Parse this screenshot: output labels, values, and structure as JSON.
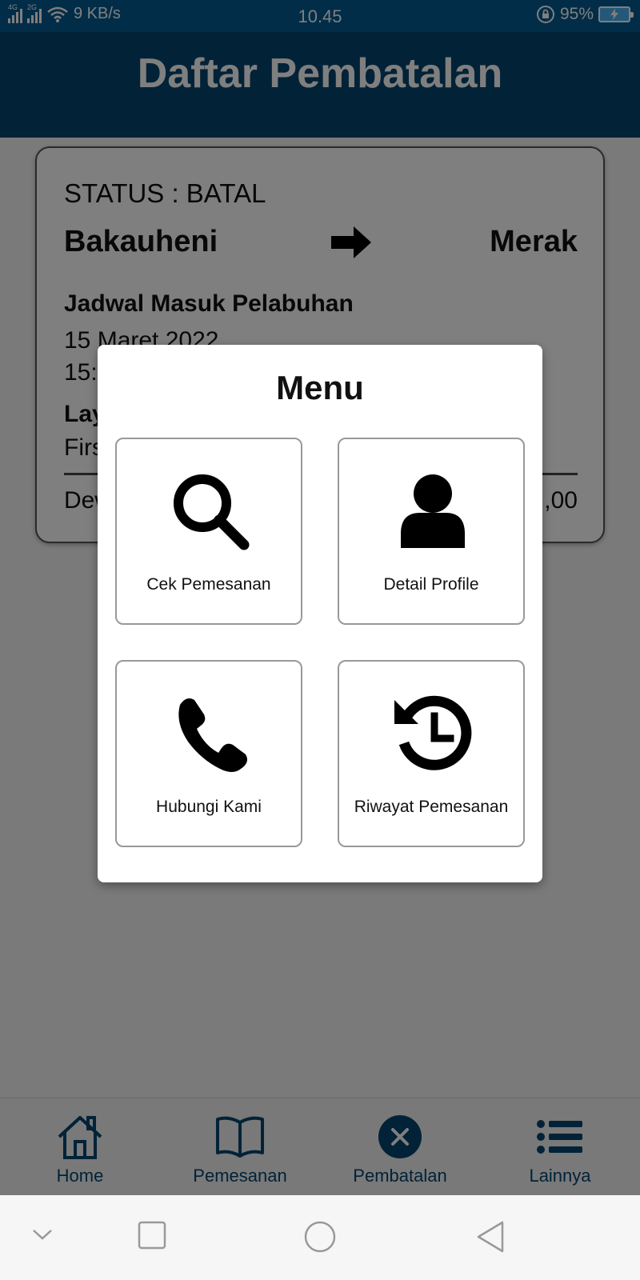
{
  "status_bar": {
    "network_1": "4G",
    "network_2": "2G",
    "speed": "9 KB/s",
    "time": "10.45",
    "battery": "95%"
  },
  "app_bar": {
    "title": "Daftar Pembatalan"
  },
  "card": {
    "status": "STATUS : BATAL",
    "origin": "Bakauheni",
    "destination": "Merak",
    "schedule_label": "Jadwal Masuk Pelabuhan",
    "schedule_date": "15 Maret 2022",
    "schedule_time": "15:",
    "service_label": "Lay",
    "service_value": "Firs",
    "total_label": "Dew",
    "total_value": ",00"
  },
  "dialog": {
    "title": "Menu",
    "tiles": [
      {
        "label": "Cek Pemesanan",
        "icon": "search-icon"
      },
      {
        "label": "Detail Profile",
        "icon": "user-icon"
      },
      {
        "label": "Hubungi Kami",
        "icon": "phone-icon"
      },
      {
        "label": "Riwayat Pemesanan",
        "icon": "history-icon"
      }
    ]
  },
  "bottom_nav": {
    "items": [
      {
        "label": "Home",
        "icon": "home-icon"
      },
      {
        "label": "Pemesanan",
        "icon": "book-icon"
      },
      {
        "label": "Pembatalan",
        "icon": "cancel-icon",
        "active": true
      },
      {
        "label": "Lainnya",
        "icon": "list-icon"
      }
    ]
  },
  "colors": {
    "status_bar": "#025b91",
    "app_bar": "#03446f",
    "nav_accent": "#03446f",
    "overlay": "rgba(0,0,0,0.5)"
  }
}
